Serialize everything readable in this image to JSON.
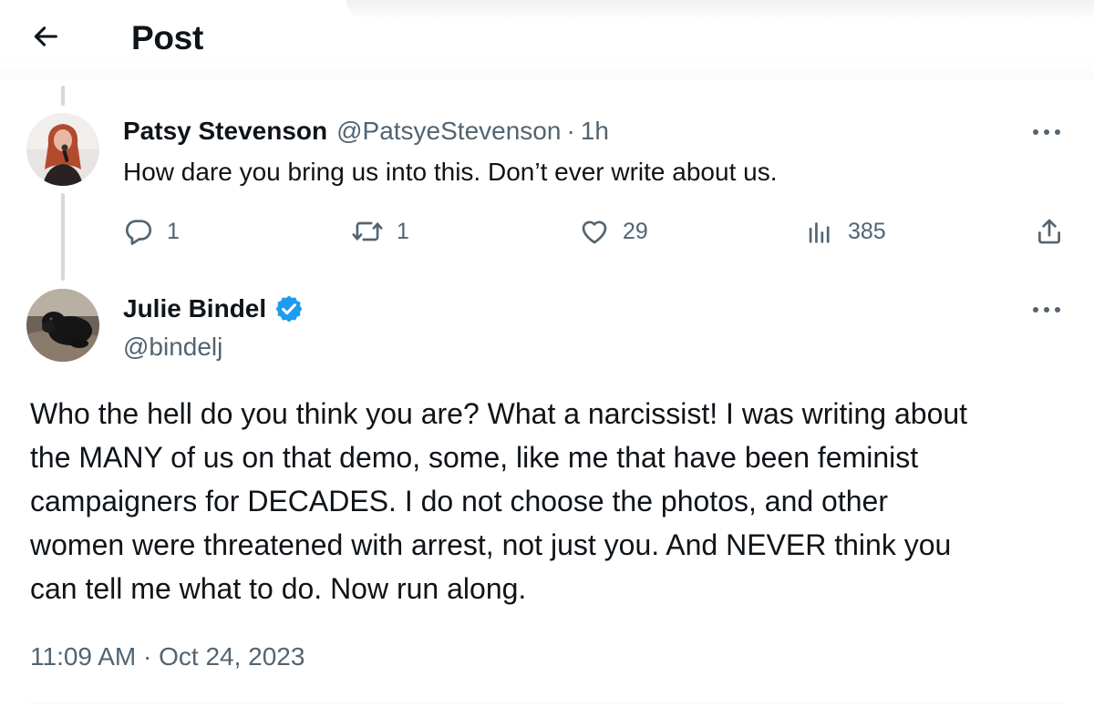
{
  "header": {
    "title": "Post",
    "back_icon": "arrow-left-icon"
  },
  "reply_tweet": {
    "author_name": "Patsy Stevenson",
    "author_handle": "@PatsyeStevenson",
    "separator": "·",
    "time": "1h",
    "text": "How dare you bring us into this. Don’t ever write about us.",
    "actions": {
      "replies": "1",
      "reposts": "1",
      "likes": "29",
      "views": "385"
    }
  },
  "main_tweet": {
    "author_name": "Julie Bindel",
    "author_handle": "@bindelj",
    "verified": true,
    "text": "Who the hell do you think you are? What a narcissist! I was writing about\nthe MANY of us on that demo, some, like me that have been feminist\ncampaigners for DECADES. I do not choose the photos, and other\nwomen were threatened with arrest, not just you. And NEVER think you\ncan tell me what to do. Now run along.",
    "timestamp": "11:09 AM · Oct 24, 2023"
  },
  "colors": {
    "text_primary": "#0f1419",
    "text_secondary": "#536471",
    "verified_blue": "#1d9bf0",
    "thread_line": "#cfd9de"
  }
}
